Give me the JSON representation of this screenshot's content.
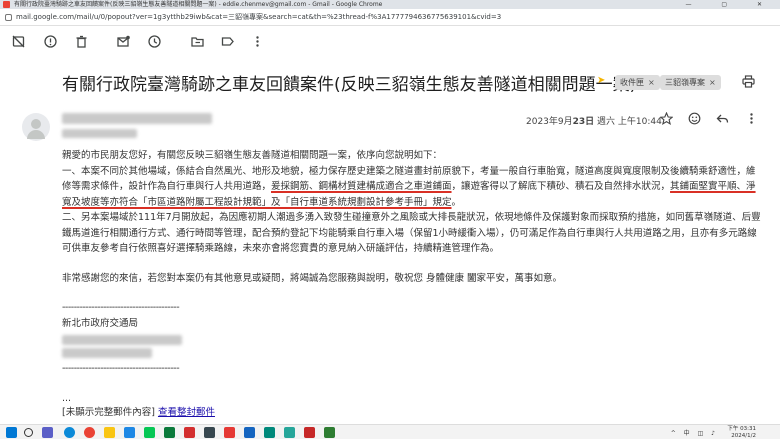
{
  "window": {
    "title": "有關行政院臺灣騎跡之車友回饋案件(反映三貂嶺生態友善隧道相關問題一案) - eddie.chenmev@gmail.com - Gmail - Google Chrome",
    "controls": "— ▢ ✕",
    "url": "mail.google.com/mail/u/0/popout?ver=1g3ytthb29iwb&cat=三貂嶺專案&search=cat&th=%23thread-f%3A1777794636775639101&cvid=3"
  },
  "toolbar": {
    "icons": [
      "move-to-inbox-icon",
      "report-spam-icon",
      "delete-icon",
      "mark-unread-icon",
      "snooze-icon",
      "move-to-icon",
      "label-icon",
      "more-vert-icon"
    ]
  },
  "email": {
    "subject": "有關行政院臺灣騎跡之車友回饋案件(反映三貂嶺生態友善隧道相關問題一案)",
    "labels": [
      {
        "text": "收件匣",
        "remove": "×"
      },
      {
        "text": "三貂嶺專案",
        "remove": "×"
      }
    ],
    "date_prefix": "2023年9月",
    "date_day": "23日",
    "date_suffix": "週六 上午10:44",
    "body": {
      "greeting": "親愛的市民朋友您好，有關您反映三貂嶺生態友善隧道相關問題一案，依序向您說明如下：",
      "p1_a": "一、本案不同於其他場域，係結合自然風光、地形及地貌，極力保存歷史建築之隧道畫封前原貌下，考量一般自行車胎寬，隧道高度與寬度限制及後續騎乘舒適性，維修等需求條件，設計作為自行車與行人共用道路，",
      "p1_u1": "爰採鋼筋、鋼構材質建構成適合之車道鋪面",
      "p1_b": "，讓遊客得以了解底下積砂、積石及自然排水狀況，",
      "p1_u2": "其鋪面堅實平順、淨寬及坡度等亦符合「市區道路附屬工程設計規範」及「自行車道系統規劃設計參考手冊」規定",
      "p1_c": "。",
      "p2": "二、另本案場域於111年7月開放起，為因應初期人潮過多湧入致發生碰撞意外之風險或大排長龍狀況，依現地條件及保護對象而採取預約措施，如同舊草嶺隧道、后豐鐵馬道進行相關通行方式、通行時間等管理，配合預約登記下均能騎乘自行車入場（保留1小時緩衝入場），仍可滿足作為自行車與行人共用道路之用，且亦有多元路線可供車友參考自行依照喜好選擇騎乘路線，未來亦會將您寶貴的意見納入研議評估，持續精進管理作為。",
      "closing": "非常感謝您的來信，若您對本案仍有其他意見或疑問，將竭誠為您服務與說明，敬祝您 身體健康 闔家平安，萬事如意。",
      "sig_line": "----------------------------------------",
      "sig_org": "新北市政府交通局",
      "ellipsis": "..."
    },
    "trimmed_text": "[未顯示完整郵件內容]",
    "trimmed_link": "查看整封郵件"
  },
  "taskbar": {
    "time": "下午 03:31",
    "date": "2024/1/2",
    "sys": "^ 中 ◫ ♪"
  },
  "colors": {
    "underline_red": "#d93025",
    "link_blue": "#1a0dab",
    "importance_yellow": "#f4b400"
  }
}
